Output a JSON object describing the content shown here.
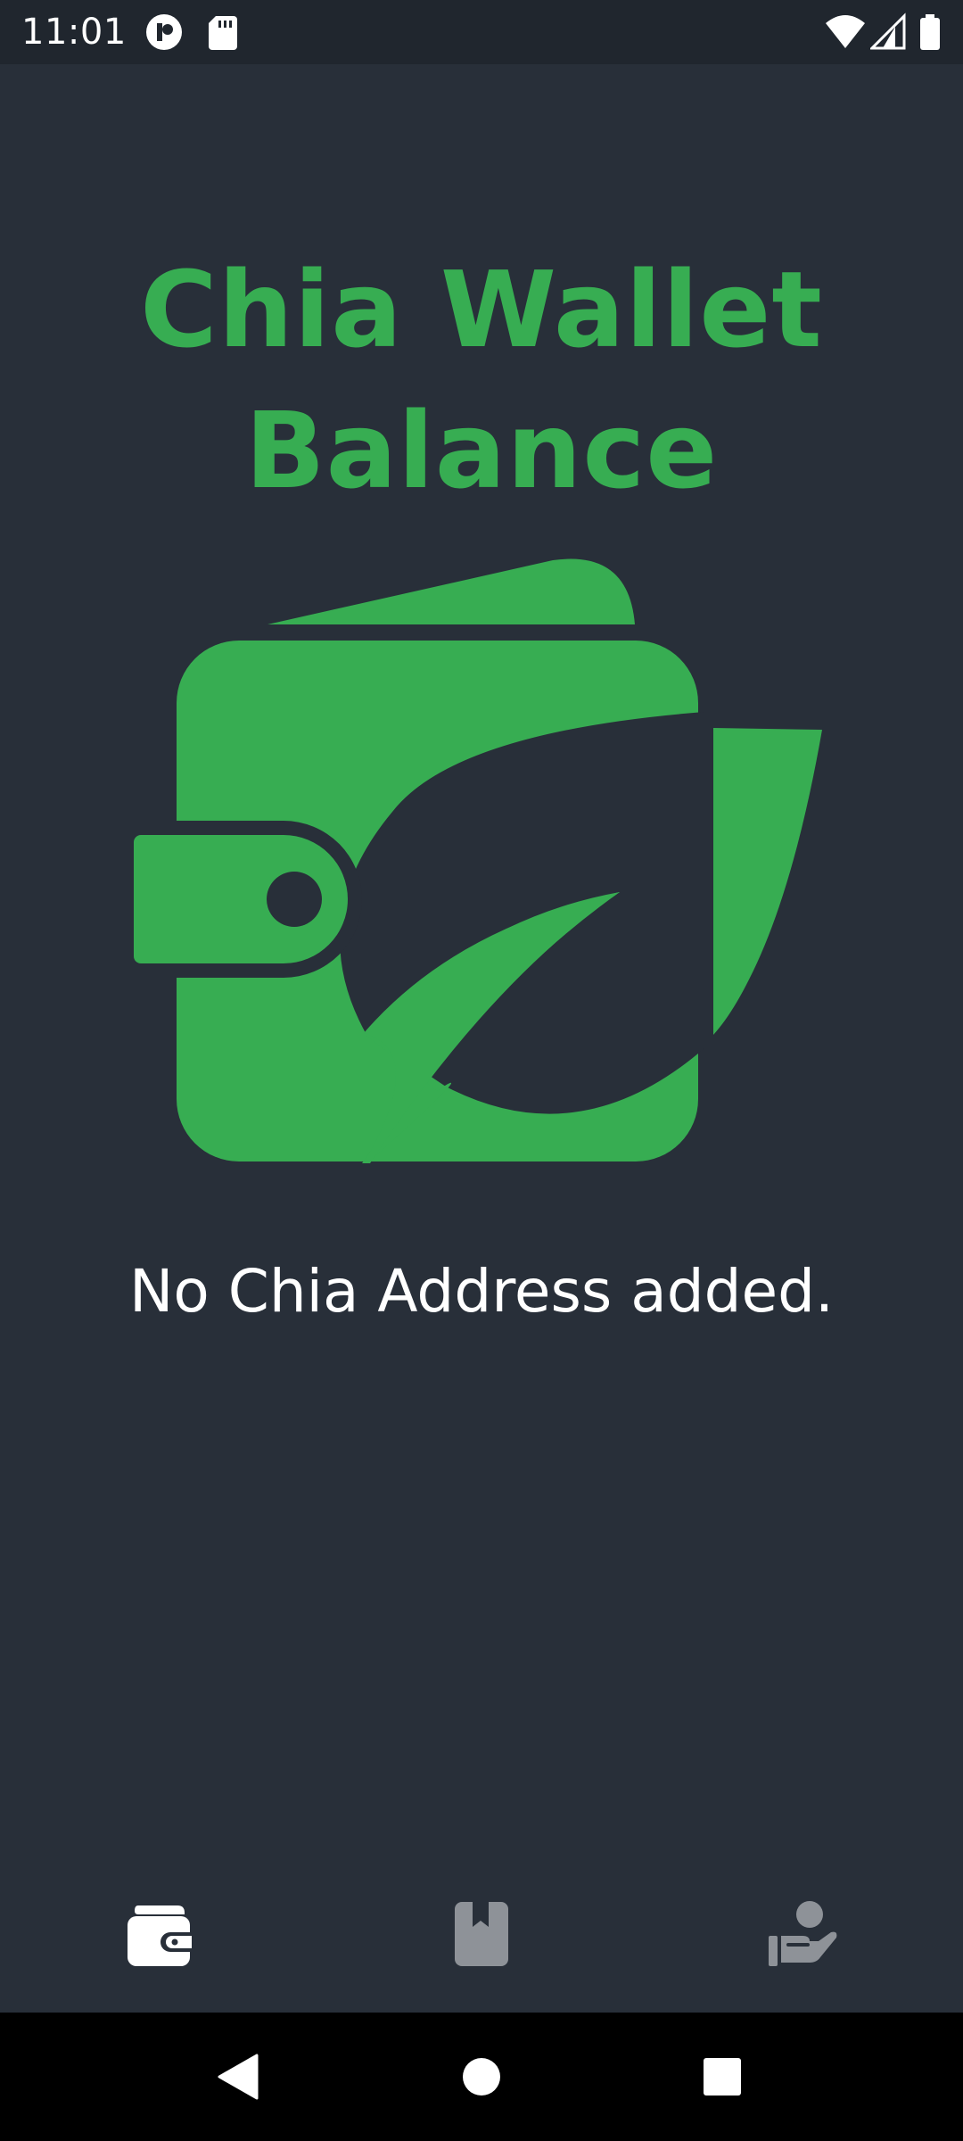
{
  "status_bar": {
    "time": "11:01",
    "left_icons": [
      "pinterest-like-icon",
      "sd-card-icon"
    ],
    "right_icons": [
      "wifi-icon",
      "cell-signal-icon",
      "battery-icon"
    ]
  },
  "header": {
    "title_line1": "Chia Wallet",
    "title_line2": "Balance"
  },
  "illustration": {
    "icon": "chia-wallet-leaf-icon"
  },
  "main": {
    "empty_message": "No Chia Address added."
  },
  "tab_bar": {
    "tabs": [
      {
        "icon": "wallet-icon",
        "active": true
      },
      {
        "icon": "bookmark-book-icon",
        "active": false
      },
      {
        "icon": "donate-person-icon",
        "active": false
      }
    ]
  },
  "nav_bar": {
    "buttons": [
      "back-triangle-icon",
      "home-circle-icon",
      "recents-square-icon"
    ]
  },
  "colors": {
    "background": "#282f39",
    "status_bar": "#20262e",
    "accent_green": "#37ad52",
    "text": "#ffffff",
    "inactive_icon": "#8e9298",
    "nav_bar": "#000000"
  }
}
